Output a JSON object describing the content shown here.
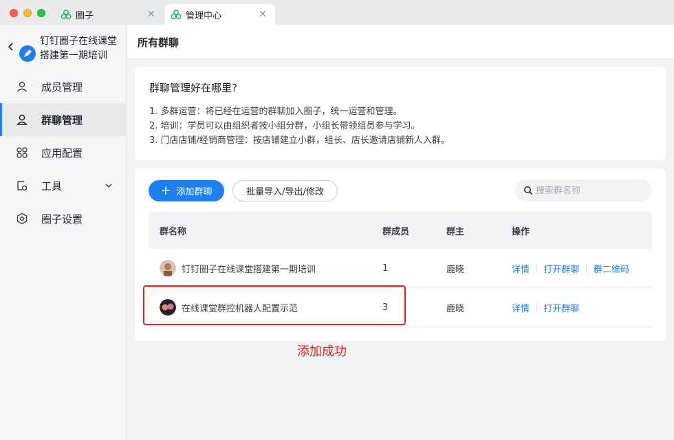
{
  "tabs": [
    {
      "label": "圈子",
      "icon": "circle-logo-icon",
      "active": false
    },
    {
      "label": "管理中心",
      "icon": "circle-logo-icon",
      "active": true
    }
  ],
  "sidebar": {
    "title": "钉钉圈子在线课堂搭建第一期培训",
    "items": [
      {
        "label": "成员管理",
        "icon": "user-icon",
        "active": false
      },
      {
        "label": "群聊管理",
        "icon": "group-chat-icon",
        "active": true
      },
      {
        "label": "应用配置",
        "icon": "apps-grid-icon",
        "active": false
      },
      {
        "label": "工具",
        "icon": "tool-icon",
        "active": false,
        "expandable": true
      },
      {
        "label": "圈子设置",
        "icon": "gear-icon",
        "active": false
      }
    ]
  },
  "main": {
    "title": "所有群聊",
    "intro": {
      "title": "群聊管理好在哪里?",
      "lines": [
        "1. 多群运营：将已经在运营的群聊加入圈子，统一运营和管理。",
        "2. 培训：学员可以由组织者按小组分群，小组长带领组员参与学习。",
        "3. 门店店铺/经销商管理：按店铺建立小群，组长、店长邀请店铺新人入群。"
      ]
    },
    "toolbar": {
      "add_label": "添加群聊",
      "batch_label": "批量导入/导出/修改",
      "search_placeholder": "搜索群名称"
    },
    "table": {
      "headers": {
        "name": "群名称",
        "members": "群成员",
        "owner": "群主",
        "actions": "操作"
      },
      "rows": [
        {
          "name": "钉钉圈子在线课堂搭建第一期培训",
          "members": "1",
          "owner": "鹿晓",
          "actions": [
            "详情",
            "打开群聊",
            "群二维码"
          ]
        },
        {
          "name": "在线课堂群控机器人配置示范",
          "members": "3",
          "owner": "鹿晓",
          "actions": [
            "详情",
            "打开群聊"
          ]
        }
      ]
    }
  },
  "annotation": {
    "text": "添加成功",
    "color": "#e0201a"
  },
  "colors": {
    "accent": "#1e7ff0",
    "highlight": "#e0201a"
  }
}
